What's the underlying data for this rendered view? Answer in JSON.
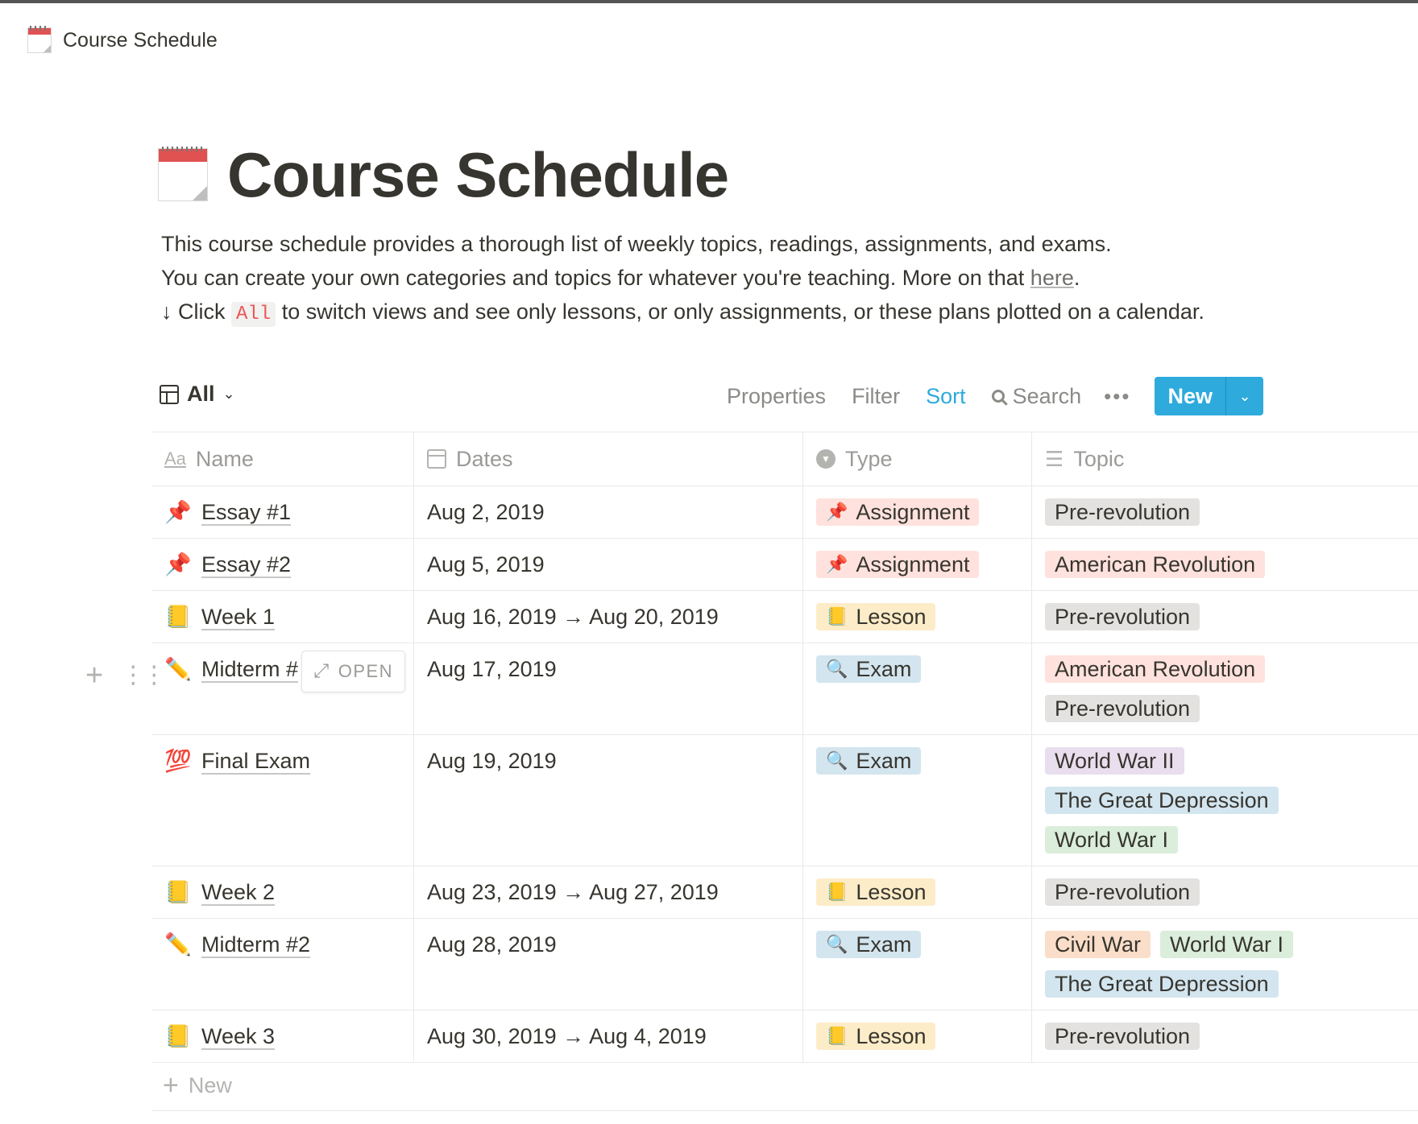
{
  "breadcrumb": {
    "title": "Course Schedule",
    "icon": "calendar-icon"
  },
  "page": {
    "title": "Course Schedule",
    "description": {
      "line1": "This course schedule provides a thorough list of weekly topics, readings, assignments, and exams.",
      "line2_pre": "You can create your own categories and topics for whatever you're teaching. More on that ",
      "line2_link": "here",
      "line2_post": ".",
      "line3_pre": "↓ Click ",
      "line3_code": "All",
      "line3_post": " to switch views and see only lessons, or only assignments, or these plans plotted on a calendar."
    }
  },
  "toolbar": {
    "view_label": "All",
    "properties": "Properties",
    "filter": "Filter",
    "sort": "Sort",
    "search": "Search",
    "more": "•••",
    "new": "New"
  },
  "columns": {
    "name": "Name",
    "dates": "Dates",
    "type": "Type",
    "topic": "Topic"
  },
  "rows": [
    {
      "emoji": "📌",
      "name": "Essay #1",
      "dates": "Aug 2, 2019",
      "type": "Assignment",
      "type_emoji": "📌",
      "type_color": "pink",
      "topics": [
        {
          "label": "Pre-revolution",
          "color": "gray"
        }
      ]
    },
    {
      "emoji": "📌",
      "name": "Essay #2",
      "dates": "Aug 5, 2019",
      "type": "Assignment",
      "type_emoji": "📌",
      "type_color": "pink",
      "topics": [
        {
          "label": "American Revolution",
          "color": "red"
        }
      ]
    },
    {
      "emoji": "📒",
      "name": "Week 1",
      "dates": "Aug 16, 2019 → Aug 20, 2019",
      "type": "Lesson",
      "type_emoji": "📒",
      "type_color": "yellow",
      "topics": [
        {
          "label": "Pre-revolution",
          "color": "gray"
        }
      ]
    },
    {
      "emoji": "✏️",
      "name": "Midterm #1",
      "dates": "Aug 17, 2019",
      "type": "Exam",
      "type_emoji": "🔍",
      "type_color": "blue",
      "topics": [
        {
          "label": "American Revolution",
          "color": "red"
        },
        {
          "label": "Pre-revolution",
          "color": "gray"
        }
      ]
    },
    {
      "emoji": "💯",
      "name": "Final Exam",
      "dates": "Aug 19, 2019",
      "type": "Exam",
      "type_emoji": "🔍",
      "type_color": "blue",
      "topics": [
        {
          "label": "World War II",
          "color": "purple"
        },
        {
          "label": "The Great Depression",
          "color": "sky"
        },
        {
          "label": "World War I",
          "color": "green"
        }
      ]
    },
    {
      "emoji": "📒",
      "name": "Week 2",
      "dates": "Aug 23, 2019 → Aug 27, 2019",
      "type": "Lesson",
      "type_emoji": "📒",
      "type_color": "yellow",
      "topics": [
        {
          "label": "Pre-revolution",
          "color": "gray"
        }
      ]
    },
    {
      "emoji": "✏️",
      "name": "Midterm #2",
      "dates": "Aug 28, 2019",
      "type": "Exam",
      "type_emoji": "🔍",
      "type_color": "blue",
      "topics": [
        {
          "label": "Civil War",
          "color": "orange"
        },
        {
          "label": "World War I",
          "color": "green"
        },
        {
          "label": "The Great Depression",
          "color": "sky"
        }
      ]
    },
    {
      "emoji": "📒",
      "name": "Week 3",
      "dates": "Aug 30, 2019 → Aug 4, 2019",
      "type": "Lesson",
      "type_emoji": "📒",
      "type_color": "yellow",
      "topics": [
        {
          "label": "Pre-revolution",
          "color": "gray"
        }
      ]
    }
  ],
  "hover": {
    "open_label": "OPEN"
  },
  "footer": {
    "new_label": "New"
  }
}
